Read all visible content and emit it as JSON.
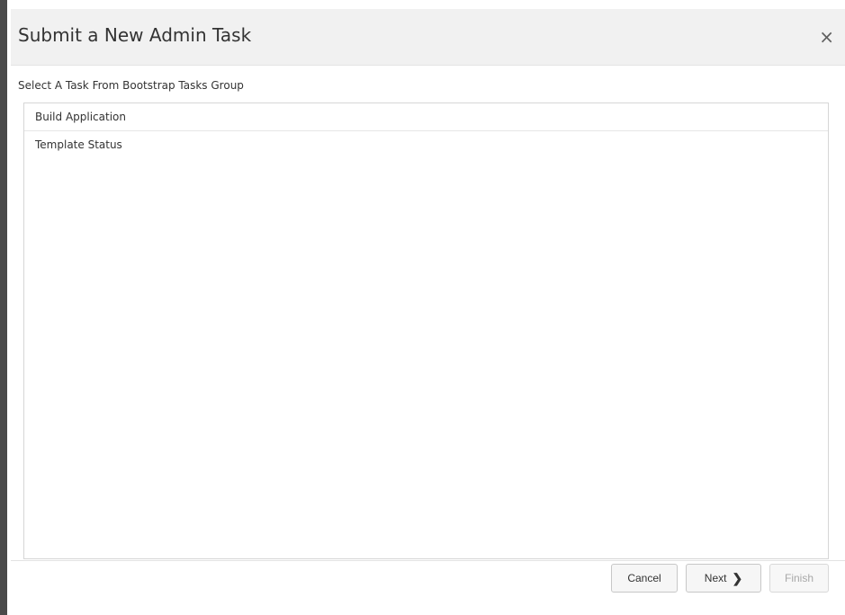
{
  "dialog": {
    "title": "Submit a New Admin Task",
    "close_label": "×"
  },
  "group": {
    "label": "Select A Task From Bootstrap Tasks Group"
  },
  "tasks": [
    {
      "label": "Build Application"
    },
    {
      "label": "Template Status"
    }
  ],
  "buttons": {
    "cancel": "Cancel",
    "next": "Next",
    "finish": "Finish"
  },
  "icons": {
    "close": "close-icon",
    "next_chevron": "chevron-right-icon"
  }
}
